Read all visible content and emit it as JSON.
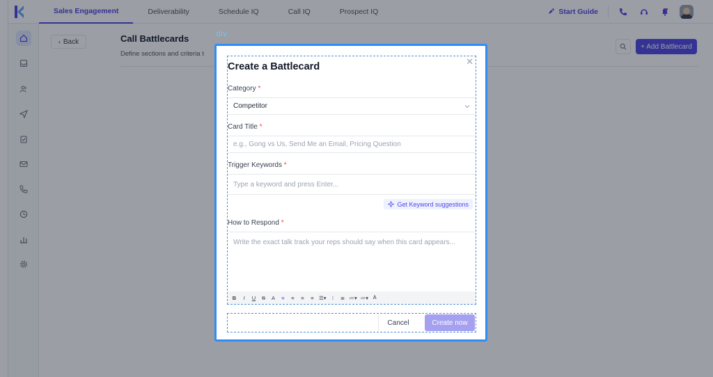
{
  "nav": {
    "tabs": [
      {
        "label": "Sales Engagement"
      },
      {
        "label": "Deliverability"
      },
      {
        "label": "Schedule IQ"
      },
      {
        "label": "Call IQ"
      },
      {
        "label": "Prospect IQ"
      }
    ],
    "start_guide": "Start Guide"
  },
  "page": {
    "back_label": "Back",
    "title": "Call Battlecards",
    "subtitle": "Define sections and criteria t",
    "add_button": "+ Add Battlecard"
  },
  "devtools": {
    "label": "div"
  },
  "modal": {
    "title": "Create a Battlecard",
    "category": {
      "label": "Category",
      "required": "*",
      "value": "Competitor"
    },
    "card_title": {
      "label": "Card Title",
      "required": "*",
      "placeholder": "e.g., Gong vs Us, Send Me an Email, Pricing Question"
    },
    "keywords": {
      "label": "Trigger Keywords",
      "required": "*",
      "placeholder": "Type a keyword and press Enter..."
    },
    "suggest_button": "Get Keyword suggestions",
    "respond": {
      "label": "How to Respond",
      "required": "*",
      "placeholder": "Write the exact talk track your reps should say when this card appears..."
    },
    "toolbar": [
      "B",
      "I",
      "U",
      "S",
      "A",
      "≡",
      "≡",
      "≡",
      "≡",
      "☰▾",
      "⁝",
      "≣",
      "≔▾",
      "≔▾",
      "Ꭺ"
    ],
    "cancel": "Cancel",
    "create": "Create now"
  },
  "colors": {
    "accent": "#4f46e5",
    "highlight": "#2e8df6",
    "required": "#ef4444"
  }
}
